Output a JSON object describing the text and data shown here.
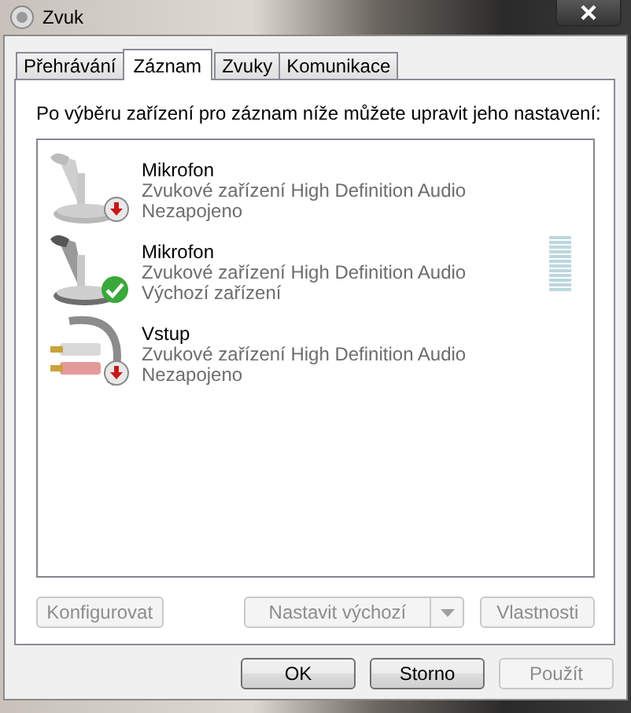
{
  "window": {
    "title": "Zvuk"
  },
  "tabs": [
    {
      "label": "Přehrávání",
      "selected": false
    },
    {
      "label": "Záznam",
      "selected": true
    },
    {
      "label": "Zvuky",
      "selected": false
    },
    {
      "label": "Komunikace",
      "selected": false
    }
  ],
  "instruction": "Po výběru zařízení pro záznam níže můžete upravit jeho nastavení:",
  "devices": [
    {
      "kind": "microphone",
      "name": "Mikrofon",
      "description": "Zvukové zařízení High Definition Audio",
      "status": "Nezapojeno",
      "connected": false,
      "default": false,
      "selected": false
    },
    {
      "kind": "microphone",
      "name": "Mikrofon",
      "description": "Zvukové zařízení High Definition Audio",
      "status": "Výchozí zařízení",
      "connected": true,
      "default": true,
      "selected": false,
      "level": 0
    },
    {
      "kind": "line",
      "name": "Vstup",
      "description": "Zvukové zařízení High Definition Audio",
      "status": "Nezapojeno",
      "connected": false,
      "default": false,
      "selected": false
    }
  ],
  "device_buttons": [
    {
      "kind": "plain",
      "label": "Konfigurovat",
      "disabled": true
    },
    {
      "kind": "split",
      "label": "Nastavit výchozí",
      "disabled": true
    },
    {
      "kind": "plain",
      "label": "Vlastnosti",
      "disabled": true
    }
  ],
  "dialog_buttons": [
    {
      "label": "OK",
      "disabled": false
    },
    {
      "label": "Storno",
      "disabled": false
    },
    {
      "label": "Použít",
      "disabled": true
    }
  ]
}
